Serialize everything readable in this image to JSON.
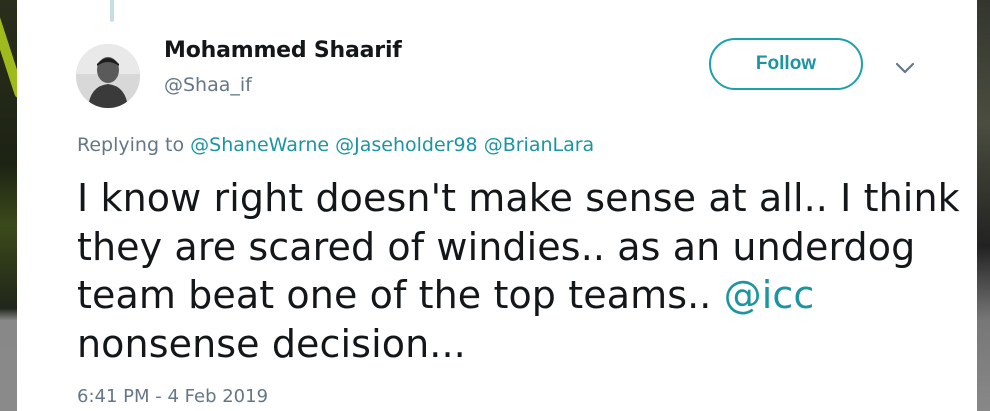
{
  "tweet": {
    "author_name": "Mohammed Shaarif",
    "author_handle": "@Shaa_if",
    "follow_label": "Follow",
    "replying_to_prefix": "Replying to",
    "replying_to": [
      "@ShaneWarne",
      "@Jaseholder98",
      "@BrianLara"
    ],
    "text_lines": [
      "I know right doesn't make sense at all.. I think",
      "they are scared of windies.. as an underdog",
      "team beat one of the top teams.. ",
      "nonsense decision..."
    ],
    "text_mention": "@icc",
    "timestamp": "6:41 PM - 4 Feb 2019",
    "accent_color": "#1b95a0",
    "icons": {
      "more": "chevron-down-icon",
      "avatar": "user-avatar"
    }
  }
}
